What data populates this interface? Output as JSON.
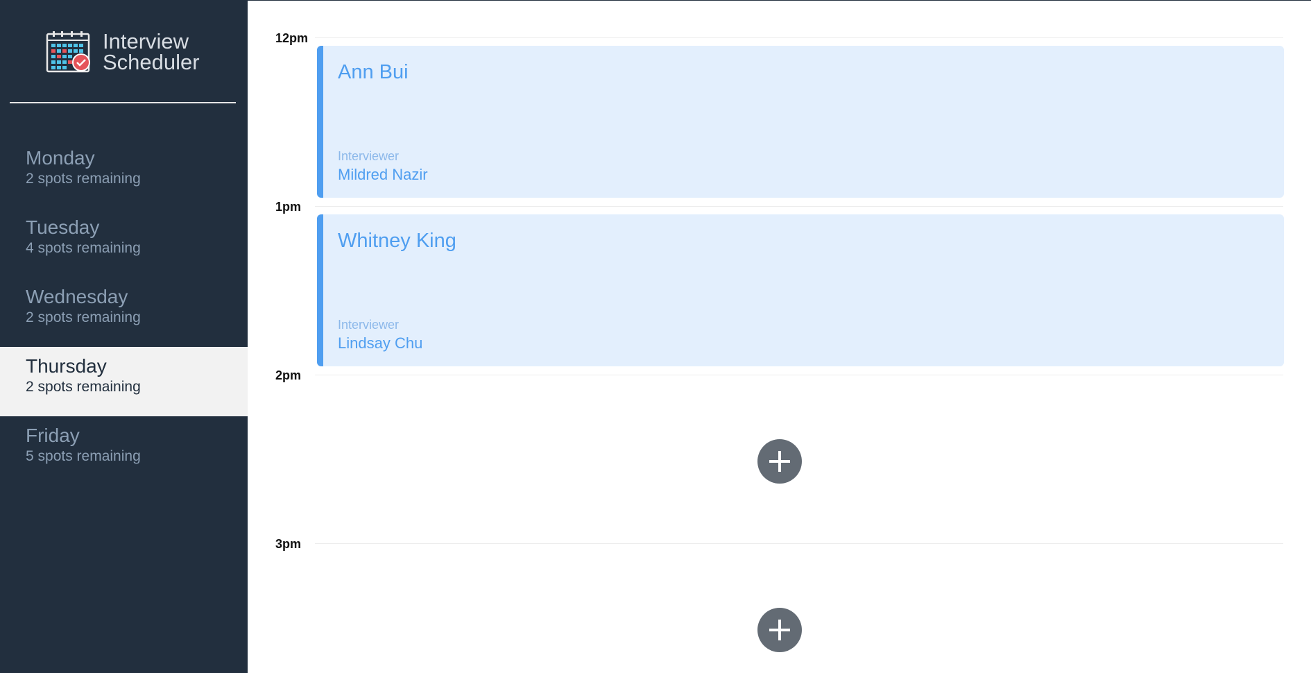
{
  "brand": {
    "line1": "Interview",
    "line2": "Scheduler"
  },
  "days": [
    {
      "name": "Monday",
      "spots": "2 spots remaining",
      "selected": false
    },
    {
      "name": "Tuesday",
      "spots": "4 spots remaining",
      "selected": false
    },
    {
      "name": "Wednesday",
      "spots": "2 spots remaining",
      "selected": false
    },
    {
      "name": "Thursday",
      "spots": "2 spots remaining",
      "selected": true
    },
    {
      "name": "Friday",
      "spots": "5 spots remaining",
      "selected": false
    }
  ],
  "schedule": {
    "slots": [
      {
        "time": "12pm",
        "student": "Ann Bui",
        "interviewer_label": "Interviewer",
        "interviewer": "Mildred Nazir"
      },
      {
        "time": "1pm",
        "student": "Whitney King",
        "interviewer_label": "Interviewer",
        "interviewer": "Lindsay Chu"
      },
      {
        "time": "2pm",
        "add_icon": "plus-icon"
      },
      {
        "time": "3pm",
        "add_icon": "plus-icon"
      }
    ]
  },
  "colors": {
    "sidebar_bg": "#222f3e",
    "selected_bg": "#f2f2f2",
    "appointment_bg": "#e3effd",
    "accent": "#4f9ef0",
    "add_button": "#636b74"
  }
}
